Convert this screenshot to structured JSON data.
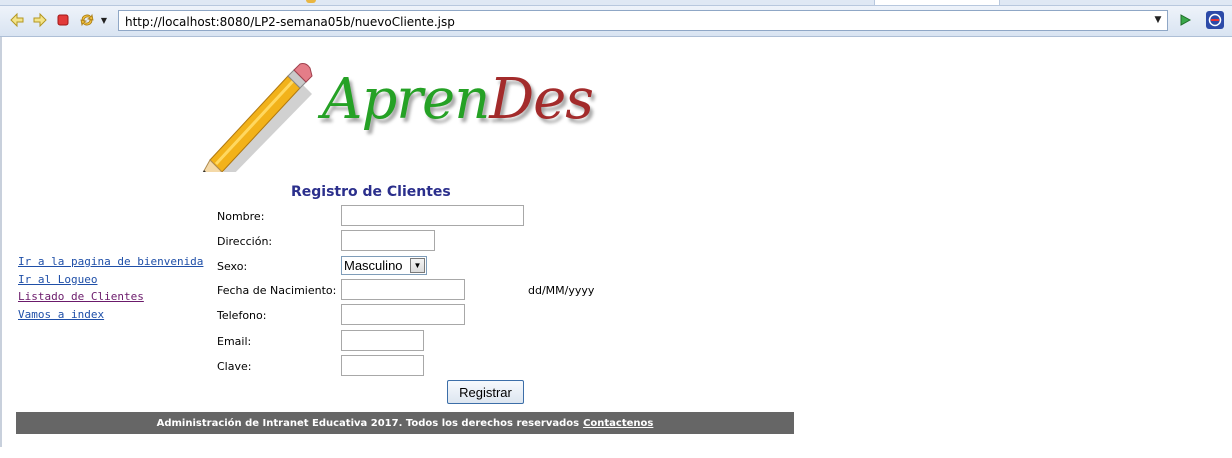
{
  "browser": {
    "url": "http://localhost:8080/LP2-semana05b/nuevoCliente.jsp"
  },
  "logo": {
    "part1": "Apren",
    "part2": "Des",
    "color1": "#25a125",
    "color2": "#a32b2b",
    "image": "pencil"
  },
  "form": {
    "title": "Registro de Clientes",
    "fields": {
      "nombre": {
        "label": "Nombre:",
        "value": ""
      },
      "direccion": {
        "label": "Dirección:",
        "value": ""
      },
      "sexo": {
        "label": "Sexo:",
        "selected": "Masculino"
      },
      "fecha": {
        "label": "Fecha de Nacimiento:",
        "value": "",
        "hint": "dd/MM/yyyy"
      },
      "telefono": {
        "label": "Telefono:",
        "value": ""
      },
      "email": {
        "label": "Email:",
        "value": ""
      },
      "clave": {
        "label": "Clave:",
        "value": ""
      }
    },
    "submit_label": "Registrar"
  },
  "links": [
    {
      "text": "Ir a la pagina de bienvenida",
      "visited": false
    },
    {
      "text": "Ir al Logueo",
      "visited": false
    },
    {
      "text": "Listado de Clientes",
      "visited": true
    },
    {
      "text": "Vamos a index",
      "visited": false
    }
  ],
  "footer": {
    "text": "Administración de Intranet Educativa 2017. Todos los derechos reservados",
    "link": "Contactenos"
  },
  "colors": {
    "title": "#2b2f8c",
    "link": "#1f4fa8",
    "visited": "#6b1a6b",
    "footer_bg": "#666666"
  }
}
